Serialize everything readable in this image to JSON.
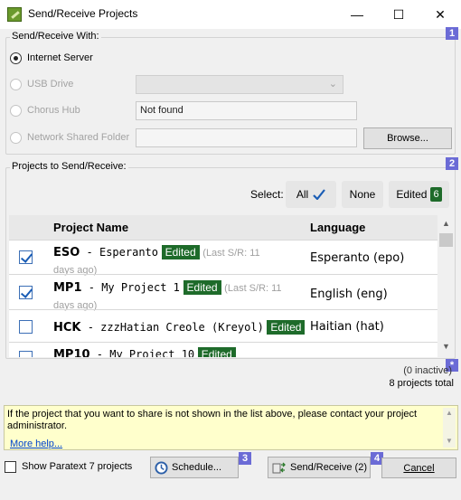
{
  "window": {
    "title": "Send/Receive Projects",
    "minimize_glyph": "—",
    "maximize_glyph": "☐",
    "close_glyph": "✕"
  },
  "send_receive_with": {
    "label": "Send/Receive With:",
    "badge": "1",
    "options": [
      {
        "label": "Internet Server",
        "checked": true,
        "enabled": true
      },
      {
        "label": "USB Drive",
        "checked": false,
        "enabled": false
      },
      {
        "label": "Chorus Hub",
        "checked": false,
        "enabled": false
      },
      {
        "label": "Network Shared Folder",
        "checked": false,
        "enabled": false
      }
    ],
    "chorus_hub_status": "Not found",
    "browse_label": "Browse..."
  },
  "projects": {
    "label": "Projects to Send/Receive:",
    "badge": "2",
    "select_label": "Select:",
    "all_label": "All",
    "none_label": "None",
    "edited_label": "Edited",
    "edited_count": "6",
    "columns": {
      "name": "Project Name",
      "language": "Language"
    },
    "rows": [
      {
        "checked": true,
        "code": "ESO",
        "name": " - Esperanto",
        "edited": "Edited",
        "last": "(Last S/R: 11",
        "last2": "days ago)",
        "language": "Esperanto (epo)"
      },
      {
        "checked": true,
        "code": "MP1",
        "name": " - My Project 1",
        "edited": "Edited",
        "last": "(Last S/R: 11",
        "last2": "days ago)",
        "language": "English (eng)"
      },
      {
        "checked": false,
        "code": "HCK",
        "name": " - zzzHatian Creole (Kreyol)",
        "edited": "Edited",
        "last": "",
        "last2": "",
        "language": "Haitian (hat)"
      },
      {
        "checked": false,
        "code": "MP10",
        "name": " - My Project 10",
        "edited": "Edited",
        "last": "",
        "last2": "",
        "language": ""
      }
    ],
    "inactive": "(0 inactive)",
    "total": "8 projects total",
    "badge_star": "*"
  },
  "info": {
    "message": "If the project that you want to share is not shown in the list above, please contact your project administrator.",
    "link": "More help..."
  },
  "footer": {
    "show_p7": "Show Paratext 7 projects",
    "schedule": "Schedule...",
    "schedule_badge": "3",
    "send_receive": "Send/Receive (2)",
    "send_badge": "4",
    "cancel": "Cancel"
  },
  "colors": {
    "accent_badge": "#6b6bd6",
    "edited_green": "#1e6b2a",
    "info_bg": "#ffffcc"
  }
}
